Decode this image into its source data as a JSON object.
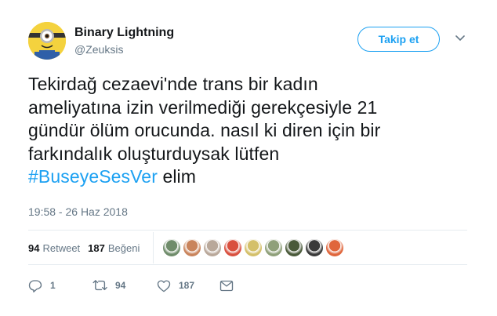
{
  "author": {
    "name": "Binary Lightning",
    "handle": "@Zeuksis"
  },
  "follow_label": "Takip et",
  "tweet": {
    "text_lines": [
      "Tekirdağ cezaevi'nde trans bir kadın",
      "ameliyatına izin verilmediği gerekçesiyle 21",
      "gündür ölüm orucunda. nasıl ki diren için bir",
      "farkındalık oluşturduysak lütfen"
    ],
    "hashtag": "#BuseyeSesVer",
    "tail": " elim",
    "timestamp": "19:58 - 26 Haz 2018"
  },
  "stats": {
    "retweet_count": "94",
    "retweet_label": "Retweet",
    "like_count": "187",
    "like_label": "Beğeni"
  },
  "actions": {
    "reply_count": "1",
    "retweet_count": "94",
    "like_count": "187"
  },
  "colors": {
    "accent": "#1da1f2",
    "muted": "#657786",
    "text": "#14171a",
    "divider": "#e6ecf0"
  },
  "liker_avatar_colors": [
    "#6f8c6a",
    "#c9845c",
    "#b9a89a",
    "#d9503f",
    "#d4c06a",
    "#8fa07a",
    "#4a5a3a",
    "#3a3a3a",
    "#e0663c"
  ]
}
